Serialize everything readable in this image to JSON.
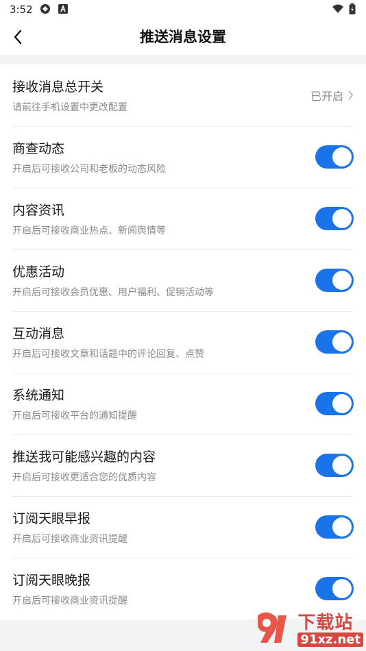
{
  "status_bar": {
    "time": "3:52"
  },
  "header": {
    "title": "推送消息设置"
  },
  "master": {
    "title": "接收消息总开关",
    "subtitle": "请前往手机设置中更改配置",
    "status": "已开启"
  },
  "items": [
    {
      "title": "商查动态",
      "subtitle": "开启后可接收公司和老板的动态风险",
      "on": true
    },
    {
      "title": "内容资讯",
      "subtitle": "开启后可接收商业热点、新闻舆情等",
      "on": true
    },
    {
      "title": "优惠活动",
      "subtitle": "开启后可接收会员优惠、用户福利、促销活动等",
      "on": true
    },
    {
      "title": "互动消息",
      "subtitle": "开启后可接收文章和话题中的评论回复、点赞",
      "on": true
    },
    {
      "title": "系统通知",
      "subtitle": "开启后可接收平台的通知提醒",
      "on": true
    },
    {
      "title": "推送我可能感兴趣的内容",
      "subtitle": "开启后可接收更适合您的优质内容",
      "on": true
    },
    {
      "title": "订阅天眼早报",
      "subtitle": "开启后可接收商业资讯提醒",
      "on": true
    },
    {
      "title": "订阅天眼晚报",
      "subtitle": "开启后可接收商业资讯提醒",
      "on": true
    }
  ],
  "watermark": {
    "main": "下载站",
    "domain": "91xz.net"
  },
  "colors": {
    "toggle_on": "#1a73e8",
    "watermark": "#d43a33"
  }
}
